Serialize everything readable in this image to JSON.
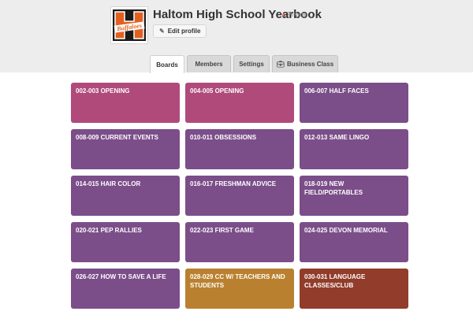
{
  "profile": {
    "name": "Haltom High School Yearbook",
    "privacy": "Private",
    "edit_label": "Edit profile",
    "logo_text": "Buffaloes",
    "logo_letter": "H"
  },
  "tabs": [
    {
      "label": "Boards",
      "active": true
    },
    {
      "label": "Members",
      "active": false
    },
    {
      "label": "Settings",
      "active": false
    },
    {
      "label": "Business Class",
      "active": false
    }
  ],
  "colors": {
    "pink": "#b04a7b",
    "purple": "#7b4e89",
    "orange": "#b9812f",
    "red": "#923c2b",
    "private_icon": "#cf513d"
  },
  "boards": [
    {
      "name": "002-003 OPENING",
      "color": "pink"
    },
    {
      "name": "004-005 OPENING",
      "color": "pink"
    },
    {
      "name": "006-007 HALF FACES",
      "color": "purple"
    },
    {
      "name": "008-009 CURRENT EVENTS",
      "color": "purple"
    },
    {
      "name": "010-011 OBSESSIONS",
      "color": "purple"
    },
    {
      "name": "012-013 SAME LINGO",
      "color": "purple"
    },
    {
      "name": "014-015 HAIR COLOR",
      "color": "purple"
    },
    {
      "name": "016-017 FRESHMAN ADVICE",
      "color": "purple"
    },
    {
      "name": "018-019 NEW FIELD/PORTABLES",
      "color": "purple"
    },
    {
      "name": "020-021 PEP RALLIES",
      "color": "purple"
    },
    {
      "name": "022-023 FIRST GAME",
      "color": "purple"
    },
    {
      "name": "024-025 DEVON MEMORIAL",
      "color": "purple"
    },
    {
      "name": "026-027 HOW TO SAVE A LIFE",
      "color": "purple"
    },
    {
      "name": "028-029 CC W/ TEACHERS AND STUDENTS",
      "color": "orange"
    },
    {
      "name": "030-031 LANGUAGE CLASSES/CLUB",
      "color": "red"
    }
  ]
}
